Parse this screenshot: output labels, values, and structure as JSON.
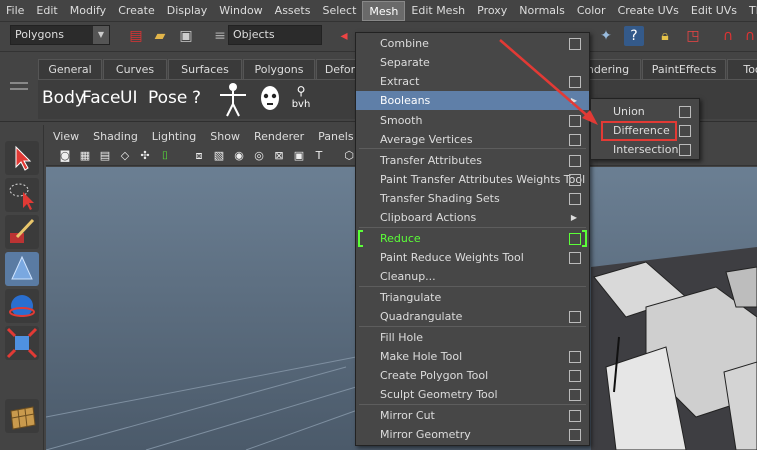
{
  "menubar": [
    "File",
    "Edit",
    "Modify",
    "Create",
    "Display",
    "Window",
    "Assets",
    "Select",
    "Mesh",
    "Edit Mesh",
    "Proxy",
    "Normals",
    "Color",
    "Create UVs",
    "Edit UVs",
    "The Set"
  ],
  "active_menu": "Mesh",
  "statusline": {
    "mode": "Polygons",
    "select_field": "Objects"
  },
  "shelf": {
    "tabs": [
      "General",
      "Curves",
      "Surfaces",
      "Polygons",
      "Defor",
      "ndering",
      "PaintEffects",
      "Toon"
    ],
    "buttons": [
      "Body",
      "Face",
      "UI",
      "Pose",
      "?",
      "bvh"
    ]
  },
  "panel": {
    "menu": [
      "View",
      "Shading",
      "Lighting",
      "Show",
      "Renderer",
      "Panels"
    ]
  },
  "mesh_menu": {
    "items": [
      {
        "label": "Combine",
        "option": true
      },
      {
        "label": "Separate",
        "option": false
      },
      {
        "label": "Extract",
        "option": true
      },
      {
        "label": "Booleans",
        "submenu": true,
        "highlighted": true
      },
      {
        "label": "Smooth",
        "option": true
      },
      {
        "label": "Average Vertices",
        "option": true
      },
      {
        "label": "Transfer Attributes",
        "option": true
      },
      {
        "label": "Paint Transfer Attributes Weights Tool",
        "option": true
      },
      {
        "label": "Transfer Shading Sets",
        "option": true
      },
      {
        "label": "Clipboard Actions",
        "submenu": true
      },
      {
        "label": "Reduce",
        "option": true,
        "green": true
      },
      {
        "label": "Paint Reduce Weights Tool",
        "option": true
      },
      {
        "label": "Cleanup...",
        "option": false
      },
      {
        "label": "Triangulate",
        "option": false
      },
      {
        "label": "Quadrangulate",
        "option": true
      },
      {
        "label": "Fill Hole",
        "option": false
      },
      {
        "label": "Make Hole Tool",
        "option": true
      },
      {
        "label": "Create Polygon Tool",
        "option": true
      },
      {
        "label": "Sculpt Geometry Tool",
        "option": true
      },
      {
        "label": "Mirror Cut",
        "option": true
      },
      {
        "label": "Mirror Geometry",
        "option": true
      }
    ]
  },
  "booleans_submenu": {
    "items": [
      "Union",
      "Difference",
      "Intersection"
    ],
    "highlighted": "Difference"
  },
  "colors": {
    "highlight": "#5f7fa8",
    "green": "#5bff38",
    "annotation": "#e23a35"
  }
}
